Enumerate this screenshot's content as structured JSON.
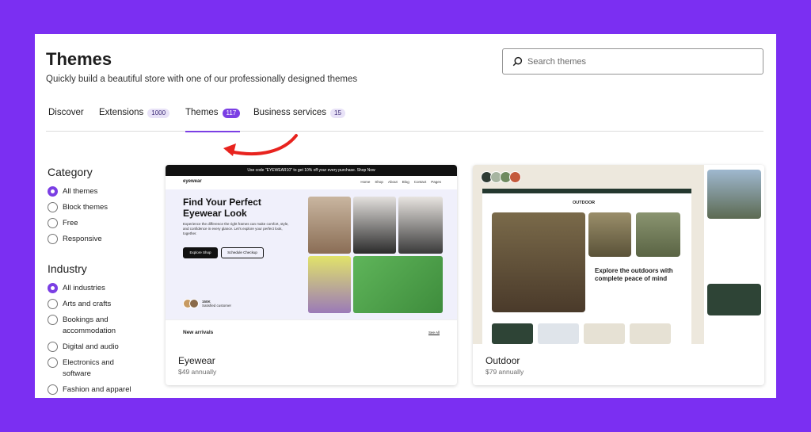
{
  "header": {
    "title": "Themes",
    "subtitle": "Quickly build a beautiful store with one of our professionally designed themes"
  },
  "search": {
    "placeholder": "Search themes",
    "icon": "search-icon"
  },
  "tabs": [
    {
      "label": "Discover",
      "count": null,
      "active": false
    },
    {
      "label": "Extensions",
      "count": "1000",
      "active": false
    },
    {
      "label": "Themes",
      "count": "117",
      "active": true
    },
    {
      "label": "Business services",
      "count": "15",
      "active": false
    }
  ],
  "sidebar": {
    "category": {
      "title": "Category",
      "options": [
        {
          "label": "All themes",
          "checked": true
        },
        {
          "label": "Block themes",
          "checked": false
        },
        {
          "label": "Free",
          "checked": false
        },
        {
          "label": "Responsive",
          "checked": false
        }
      ]
    },
    "industry": {
      "title": "Industry",
      "options": [
        {
          "label": "All industries",
          "checked": true
        },
        {
          "label": "Arts and crafts",
          "checked": false
        },
        {
          "label": "Bookings and accommodation",
          "checked": false
        },
        {
          "label": "Digital and audio",
          "checked": false
        },
        {
          "label": "Electronics and software",
          "checked": false
        },
        {
          "label": "Fashion and apparel",
          "checked": false
        }
      ]
    }
  },
  "themes": [
    {
      "name": "Eyewear",
      "price": "$49 annually",
      "preview": {
        "promo": "Use code \"EYEWEAR10\" to get 10% off your every purchase. Shop Now",
        "logo": "eyewear",
        "menu": [
          "Home",
          "Shop",
          "About",
          "Blog",
          "Contact",
          "Pages"
        ],
        "headline": "Find Your Perfect Eyewear Look",
        "body": "Experience the difference the right frames can make comfort, style, and confidence in every glance. Let's explore your perfect look, together.",
        "primary_cta": "Explore Shop",
        "secondary_cta": "Schedule Checkup",
        "stat": "150K",
        "stat_label": "Satisfied customer",
        "section": "New arrivals",
        "see_all": "See All"
      }
    },
    {
      "name": "Outdoor",
      "price": "$79 annually",
      "preview": {
        "logo": "OUTDOOR",
        "headline": "Explore the outdoors with complete peace of mind",
        "swatches": [
          "#2e3b33",
          "#a7b5a1",
          "#6f8a5f",
          "#c45a3c"
        ]
      }
    }
  ],
  "colors": {
    "accent": "#7b3fe4",
    "background": "#7b2ff2",
    "annotation_arrow": "#e8231e"
  }
}
